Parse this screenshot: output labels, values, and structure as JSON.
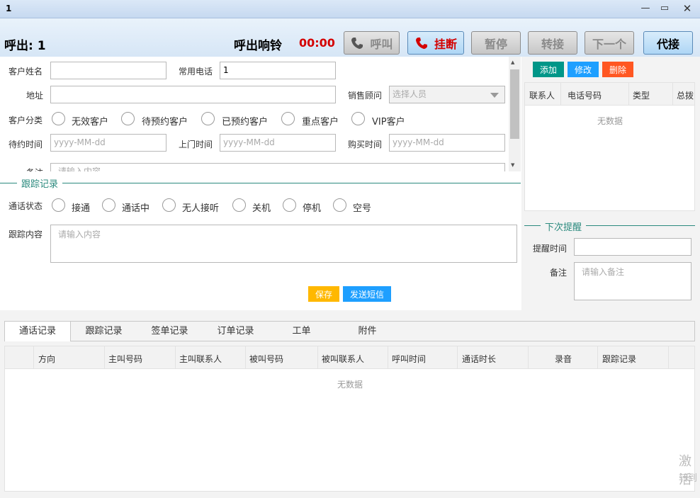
{
  "window": {
    "title": "1"
  },
  "header": {
    "call_label": "呼出: 1",
    "status_label": "呼出响铃",
    "timer": "00:00",
    "buttons": {
      "call": "呼叫",
      "hangup": "挂断",
      "pause": "暂停",
      "transfer": "转接",
      "next": "下一个",
      "proxy": "代接"
    }
  },
  "form": {
    "customer_name_label": "客户姓名",
    "customer_name_value": "",
    "phone_label": "常用电话",
    "phone_value": "1",
    "address_label": "地址",
    "address_value": "",
    "sales_label": "销售顾问",
    "sales_placeholder": "选择人员",
    "category_label": "客户分类",
    "categories": [
      "无效客户",
      "待预约客户",
      "已预约客户",
      "重点客户",
      "VIP客户"
    ],
    "appt_time_label": "待约时间",
    "visit_time_label": "上门时间",
    "buy_time_label": "购买时间",
    "date_placeholder": "yyyy-MM-dd",
    "note_label": "备注",
    "note_placeholder": "请输入内容"
  },
  "tracking": {
    "section_title": "跟踪记录",
    "call_status_label": "通话状态",
    "statuses": [
      "接通",
      "通话中",
      "无人接听",
      "关机",
      "停机",
      "空号"
    ],
    "content_label": "跟踪内容",
    "content_placeholder": "请输入内容",
    "save_button": "保存",
    "sms_button": "发送短信"
  },
  "contacts": {
    "add_button": "添加",
    "edit_button": "修改",
    "delete_button": "删除",
    "columns": [
      "联系人",
      "电话号码",
      "类型",
      "总拨"
    ],
    "empty_text": "无数据"
  },
  "reminder": {
    "section_title": "下次提醒",
    "time_label": "提醒时间",
    "note_label": "备注",
    "note_placeholder": "请输入备注"
  },
  "bottom_tabs": [
    "通话记录",
    "跟踪记录",
    "签单记录",
    "订单记录",
    "工单",
    "附件"
  ],
  "records_table": {
    "columns": [
      "方向",
      "主叫号码",
      "主叫联系人",
      "被叫号码",
      "被叫联系人",
      "呼叫时间",
      "通话时长",
      "录音",
      "跟踪记录"
    ],
    "empty_text": "无数据"
  },
  "watermark": {
    "line1": "激活",
    "line2": "转到"
  },
  "colors": {
    "teal": "#009688",
    "blue": "#1e9fff",
    "orange": "#ff5722",
    "yellow": "#ffb800"
  }
}
